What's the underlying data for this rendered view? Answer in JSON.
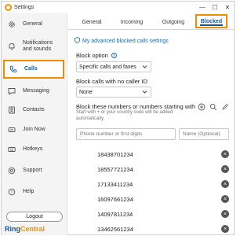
{
  "window": {
    "title": "Settings",
    "controls": {
      "minimize": "—",
      "maximize": "☐",
      "close": "✕"
    }
  },
  "sidebar": {
    "items": [
      {
        "label": "General",
        "icon": "gear-icon"
      },
      {
        "label": "Notifications and sounds",
        "icon": "bell-icon"
      },
      {
        "label": "Calls",
        "icon": "phone-icon",
        "active": true
      },
      {
        "label": "Messaging",
        "icon": "chat-icon"
      },
      {
        "label": "Contacts",
        "icon": "contacts-icon"
      },
      {
        "label": "Join Now",
        "icon": "join-now-icon"
      },
      {
        "label": "Hotkeys",
        "icon": "keyboard-icon"
      },
      {
        "label": "Support",
        "icon": "support-icon"
      },
      {
        "label": "Help",
        "icon": "help-icon"
      }
    ],
    "logout_label": "Logout",
    "brand_ring": "Ring",
    "brand_central": "Central"
  },
  "tabs": [
    {
      "label": "General"
    },
    {
      "label": "Incoming"
    },
    {
      "label": "Outgoing"
    },
    {
      "label": "Blocked",
      "active": true
    }
  ],
  "blocked": {
    "advanced_link": "My advanced blocked calls settings",
    "block_option_label": "Block option",
    "block_option_value": "Specific calls and faxes",
    "no_caller_id_label": "Block calls with no caller ID",
    "no_caller_id_value": "None",
    "block_numbers_heading": "Block these numbers or numbers starting with",
    "block_numbers_hint": "Start with + or your country code will be added automatically.",
    "phone_placeholder": "Phone number or first digits",
    "name_placeholder": "Name (Optional)",
    "numbers": [
      "18438701234",
      "18557721234",
      "17133411234",
      "16097661234",
      "14097811234",
      "13462561234"
    ]
  },
  "colors": {
    "accent_orange": "#f08c00",
    "brand_blue": "#0d5a9e",
    "link_blue": "#0d6ec0"
  }
}
